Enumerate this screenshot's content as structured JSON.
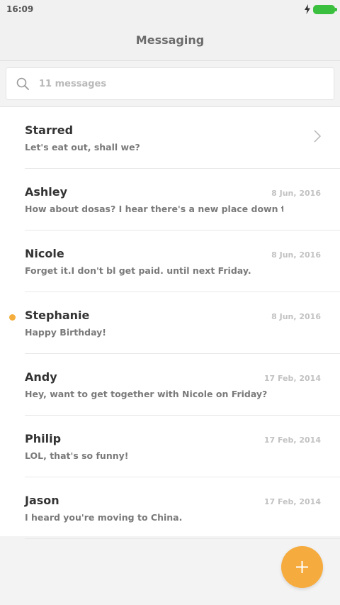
{
  "status_bar": {
    "time": "16:09"
  },
  "header": {
    "title": "Messaging"
  },
  "search": {
    "placeholder": "11 messages"
  },
  "conversations": [
    {
      "name": "Starred",
      "preview": "Let's eat out, shall we?",
      "date": "",
      "chevron": true,
      "unread": false
    },
    {
      "name": "Ashley",
      "preview": "How about dosas? I hear there's a new place down the s...",
      "date": "8 Jun, 2016",
      "chevron": false,
      "unread": false
    },
    {
      "name": "Nicole",
      "preview": "Forget it.I don't bl get paid. until next Friday.",
      "date": "8 Jun, 2016",
      "chevron": false,
      "unread": false
    },
    {
      "name": "Stephanie",
      "preview": "Happy Birthday!",
      "date": "8 Jun, 2016",
      "chevron": false,
      "unread": true
    },
    {
      "name": "Andy",
      "preview": "Hey, want to get together with Nicole on Friday?",
      "date": "17 Feb, 2014",
      "chevron": false,
      "unread": false
    },
    {
      "name": "Philip",
      "preview": "LOL, that's so funny!",
      "date": "17 Feb, 2014",
      "chevron": false,
      "unread": false
    },
    {
      "name": "Jason",
      "preview": "I heard you're moving to China.",
      "date": "17 Feb, 2014",
      "chevron": false,
      "unread": false
    }
  ],
  "colors": {
    "accent": "#f6ab3e",
    "unread_dot": "#f5ad3c",
    "battery": "#3bbf3f"
  },
  "icons": {
    "search": "search-icon",
    "chevron": "chevron-right-icon",
    "compose": "plus-icon",
    "charge": "charge-icon",
    "battery": "battery-icon"
  }
}
